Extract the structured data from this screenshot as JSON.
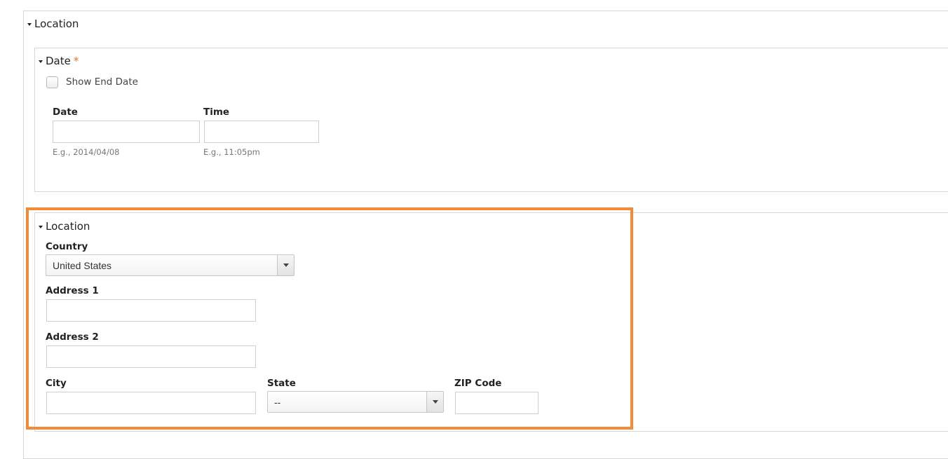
{
  "outer_section": {
    "title": "Location"
  },
  "date_section": {
    "title": "Date",
    "required_mark": "*",
    "show_end_date_label": "Show End Date",
    "show_end_date_checked": false,
    "date_label": "Date",
    "date_value": "",
    "date_hint": "E.g., 2014/04/08",
    "time_label": "Time",
    "time_value": "",
    "time_hint": "E.g., 11:05pm"
  },
  "location_section": {
    "title": "Location",
    "country_label": "Country",
    "country_selected": "United States",
    "address1_label": "Address 1",
    "address1_value": "",
    "address2_label": "Address 2",
    "address2_value": "",
    "city_label": "City",
    "city_value": "",
    "state_label": "State",
    "state_selected": "--",
    "zip_label": "ZIP Code",
    "zip_value": ""
  },
  "colors": {
    "highlight_border": "#f28b37",
    "required_star": "#e8742b",
    "panel_border": "#d6d6d6"
  }
}
